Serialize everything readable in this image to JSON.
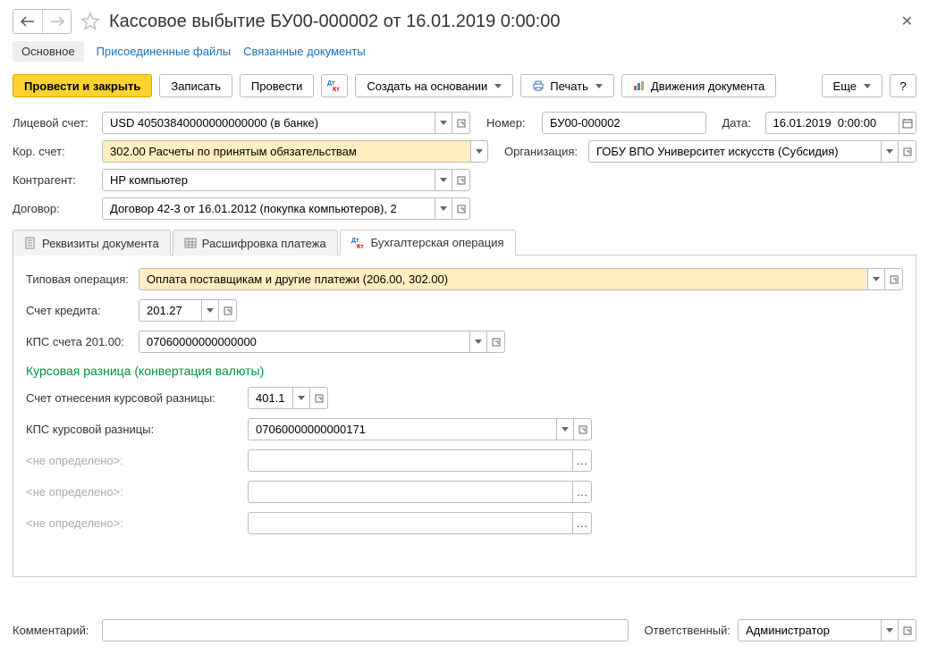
{
  "title": "Кассовое выбытие БУ00-000002 от 16.01.2019 0:00:00",
  "linkbar": {
    "main": "Основное",
    "attached": "Присоединенные файлы",
    "related": "Связанные документы"
  },
  "toolbar": {
    "post_close": "Провести и закрыть",
    "save": "Записать",
    "post": "Провести",
    "create_based": "Создать на основании",
    "print": "Печать",
    "movements": "Движения документа",
    "more": "Еще",
    "help": "?"
  },
  "labels": {
    "account": "Лицевой счет:",
    "corr_account": "Кор. счет:",
    "counterparty": "Контрагент:",
    "contract": "Договор:",
    "number": "Номер:",
    "date": "Дата:",
    "organization": "Организация:",
    "comment": "Комментарий:",
    "responsible": "Ответственный:"
  },
  "fields": {
    "account": "USD 40503840000000000000 (в банке)",
    "corr_account": "302.00 Расчеты по принятым обязательствам",
    "counterparty": "HP компьютер",
    "contract": "Договор 42-3 от 16.01.2012 (покупка компьютеров), 2",
    "number": "БУ00-000002",
    "date": "16.01.2019  0:00:00",
    "organization": "ГОБУ ВПО Университет искусств (Субсидия)",
    "comment": "",
    "responsible": "Администратор"
  },
  "tabs": {
    "requisites": "Реквизиты документа",
    "decoding": "Расшифровка платежа",
    "accounting": "Бухгалтерская операция"
  },
  "accounting_tab": {
    "labels": {
      "typical_op": "Типовая операция:",
      "credit_account": "Счет кредита:",
      "kps_201": "КПС счета 201.00:",
      "section": "Курсовая разница (конвертация валюты)",
      "diff_account": "Счет отнесения курсовой разницы:",
      "kps_diff": "КПС курсовой разницы:",
      "undefined": "<не определено>:"
    },
    "values": {
      "typical_op": "Оплата поставщикам и другие платежи (206.00, 302.00)",
      "credit_account": "201.27",
      "kps_201": "07060000000000000",
      "diff_account": "401.10",
      "kps_diff": "07060000000000171"
    }
  }
}
